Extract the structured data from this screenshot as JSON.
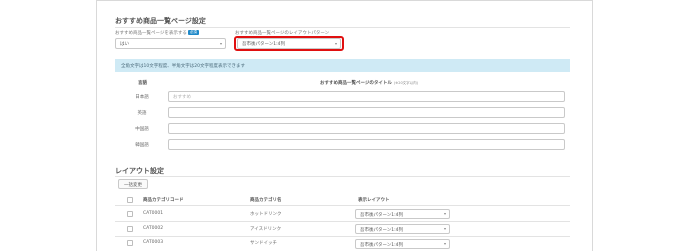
{
  "recommended_settings": {
    "title": "おすすめ商品一覧ページ設定",
    "display_field": {
      "label": "おすすめ商品一覧ページを表示する",
      "required_badge": "必須",
      "value": "はい"
    },
    "layout_field": {
      "label": "おすすめ商品一覧ページのレイアウトパターン",
      "value": "吾市後パターン1:4列"
    },
    "note": "全角文字は10文字程度、半角文字は20文字程度表示できます"
  },
  "title_table": {
    "header_language": "言語",
    "header_title": "おすすめ商品一覧ページのタイトル",
    "header_title_sub": "(※20文字以内)",
    "rows": [
      {
        "language": "日本語",
        "placeholder": "おすすめ"
      },
      {
        "language": "英語",
        "placeholder": ""
      },
      {
        "language": "中国語",
        "placeholder": ""
      },
      {
        "language": "韓国語",
        "placeholder": ""
      }
    ]
  },
  "layout_settings": {
    "title": "レイアウト設定",
    "bulk_button": "一括変更",
    "headers": {
      "category_code": "商品カテゴリコード",
      "category_name": "商品カテゴリ名",
      "display_layout": "表示レイアウト"
    },
    "rows": [
      {
        "code": "CAT0001",
        "name": "ホットドリンク",
        "layout": "吾市後パターン1:4列"
      },
      {
        "code": "CAT0002",
        "name": "アイスドリンク",
        "layout": "吾市後パターン1:4列"
      },
      {
        "code": "CAT0003",
        "name": "サンドイッチ",
        "layout": "吾市後パターン1:4列"
      }
    ]
  },
  "icons": {
    "caret": "chevron-down-icon"
  },
  "colors": {
    "highlight": "#e01010",
    "note_bg": "#cfeaf5",
    "badge": "#1e88c8"
  }
}
